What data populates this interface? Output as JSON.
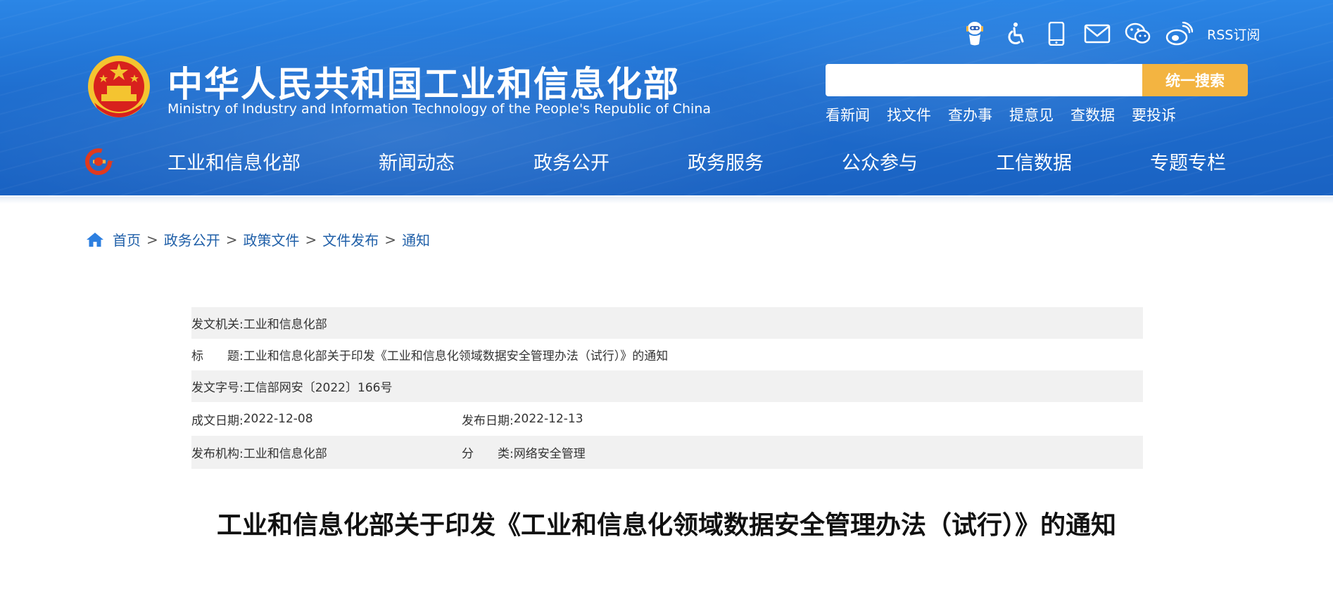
{
  "header": {
    "title_cn": "中华人民共和国工业和信息化部",
    "title_en": "Ministry of Industry and Information Technology of the People's Republic of China",
    "rss_label": "RSS订阅",
    "search_placeholder": "",
    "search_button": "统一搜索",
    "quick_links": [
      "看新闻",
      "找文件",
      "查办事",
      "提意见",
      "查数据",
      "要投诉"
    ],
    "icons": [
      "robot-assistant-icon",
      "accessibility-icon",
      "mobile-icon",
      "mail-icon",
      "wechat-icon",
      "weibo-icon"
    ]
  },
  "nav": {
    "items": [
      "工业和信息化部",
      "新闻动态",
      "政务公开",
      "政务服务",
      "公众参与",
      "工信数据",
      "专题专栏"
    ]
  },
  "breadcrumb": {
    "items": [
      "首页",
      "政务公开",
      "政策文件",
      "文件发布",
      "通知"
    ],
    "separator": ">"
  },
  "meta": {
    "issuer_label": "发文机关:",
    "issuer": "工业和信息化部",
    "title_label": "标　　题:",
    "title": "工业和信息化部关于印发《工业和信息化领域数据安全管理办法（试行）》的通知",
    "docno_label": "发文字号:",
    "docno": "工信部网安〔2022〕166号",
    "created_label": "成文日期:",
    "created": "2022-12-08",
    "published_label": "发布日期:",
    "published": "2022-12-13",
    "org_label": "发布机构:",
    "org": "工业和信息化部",
    "category_label": "分　　类:",
    "category": "网络安全管理"
  },
  "article": {
    "title": "工业和信息化部关于印发《工业和信息化领域数据安全管理办法（试行）》的通知"
  },
  "colors": {
    "header_blue": "#1f6fd0",
    "search_button": "#f3b441",
    "breadcrumb_link": "#1f5fa8",
    "meta_row_shade": "#f1f1f1"
  }
}
